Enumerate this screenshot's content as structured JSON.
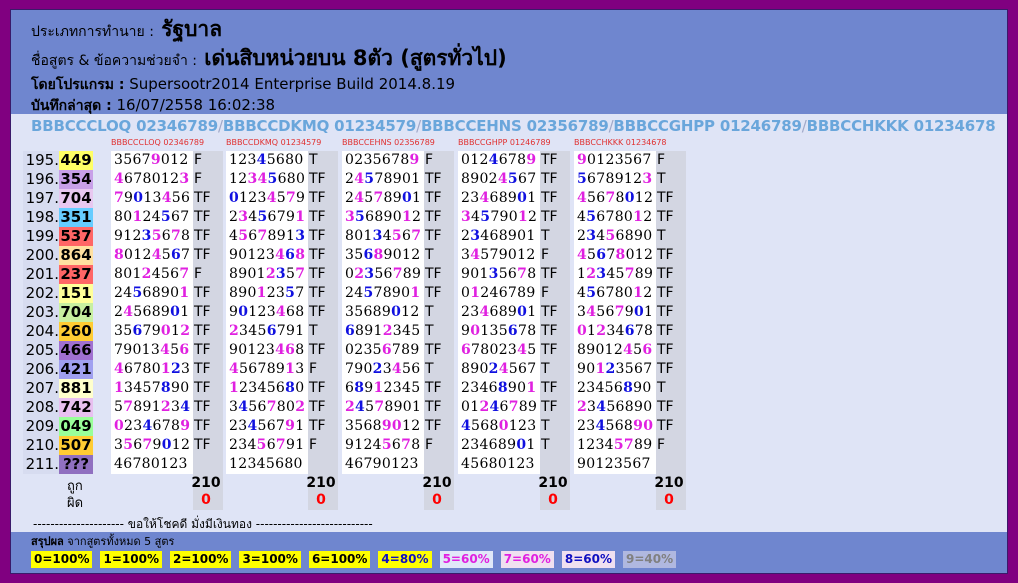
{
  "header": {
    "type_label": "ประเภทการทำนาย :",
    "type_value": "รัฐบาล",
    "formula_label": "ชื่อสูตร & ข้อความช่วยจำ :",
    "formula_value": "เด่นสิบหน่วยบน 8ตัว (สูตรทั่วไป)",
    "program_label": "โดยโปรแกรม :",
    "program_value": "Supersootr2014 Enterprise Build 2014.8.19",
    "saved_label": "บันทึกล่าสุด :",
    "saved_value": "16/07/2558 16:02:38"
  },
  "formulas": [
    {
      "name": "BBBCCCLOQ",
      "digits": "02346789"
    },
    {
      "name": "BBBCCDKMQ",
      "digits": "01234579"
    },
    {
      "name": "BBBCCEHNS",
      "digits": "02356789"
    },
    {
      "name": "BBBCCGHPP",
      "digits": "01246789"
    },
    {
      "name": "BBBCCHKKK",
      "digits": "01234678"
    }
  ],
  "column_names": [
    "BBBCCCLOQ 02346789",
    "BBBCCDKMQ 01234579",
    "BBBCCEHNS 02356789",
    "BBBCCGHPP 01246789",
    "BBBCCHKKK 01234678"
  ],
  "draws": [
    {
      "idx": "195.",
      "result": "449",
      "color": "#ffff66"
    },
    {
      "idx": "196.",
      "result": "354",
      "color": "#c8a0e8"
    },
    {
      "idx": "197.",
      "result": "704",
      "color": "#e8c8f0"
    },
    {
      "idx": "198.",
      "result": "351",
      "color": "#66ccff"
    },
    {
      "idx": "199.",
      "result": "537",
      "color": "#ff6666"
    },
    {
      "idx": "200.",
      "result": "864",
      "color": "#ffe0a0"
    },
    {
      "idx": "201.",
      "result": "237",
      "color": "#ff6666"
    },
    {
      "idx": "202.",
      "result": "151",
      "color": "#ffff99"
    },
    {
      "idx": "203.",
      "result": "704",
      "color": "#c8f0a0"
    },
    {
      "idx": "204.",
      "result": "260",
      "color": "#ffcc33"
    },
    {
      "idx": "205.",
      "result": "466",
      "color": "#a070d0"
    },
    {
      "idx": "206.",
      "result": "421",
      "color": "#a0a0f0"
    },
    {
      "idx": "207.",
      "result": "881",
      "color": "#ffffcc"
    },
    {
      "idx": "208.",
      "result": "742",
      "color": "#e8c0f0"
    },
    {
      "idx": "209.",
      "result": "049",
      "color": "#99ff99"
    },
    {
      "idx": "210.",
      "result": "507",
      "color": "#ffcc33"
    },
    {
      "idx": "211.",
      "result": "???",
      "color": "#9070c0"
    }
  ],
  "columns": [
    {
      "cells": [
        [
          "35679012",
          "F"
        ],
        [
          "46780123",
          "F"
        ],
        [
          "79013456",
          "TF"
        ],
        [
          "80124567",
          "TF"
        ],
        [
          "91235678",
          "TF"
        ],
        [
          "80124567",
          "TF"
        ],
        [
          "80124567",
          "F"
        ],
        [
          "24568901",
          "TF"
        ],
        [
          "24568901",
          "TF"
        ],
        [
          "35679012",
          "TF"
        ],
        [
          "79013456",
          "TF"
        ],
        [
          "46780123",
          "TF"
        ],
        [
          "13457890",
          "TF"
        ],
        [
          "57891234",
          "TF"
        ],
        [
          "02346789",
          "TF"
        ],
        [
          "35679012",
          "TF"
        ],
        [
          "46780123",
          ""
        ]
      ],
      "correct": "210",
      "wrong": "0"
    },
    {
      "cells": [
        [
          "12345680",
          "T"
        ],
        [
          "12345680",
          "TF"
        ],
        [
          "01234579",
          "TF"
        ],
        [
          "23456791",
          "TF"
        ],
        [
          "45678913",
          "TF"
        ],
        [
          "90123468",
          "TF"
        ],
        [
          "89012357",
          "TF"
        ],
        [
          "89012357",
          "TF"
        ],
        [
          "90123468",
          "TF"
        ],
        [
          "23456791",
          "T"
        ],
        [
          "90123468",
          "TF"
        ],
        [
          "45678913",
          "F"
        ],
        [
          "12345680",
          "TF"
        ],
        [
          "34567802",
          "TF"
        ],
        [
          "23456791",
          "TF"
        ],
        [
          "23456791",
          "F"
        ],
        [
          "12345680",
          ""
        ]
      ],
      "correct": "210",
      "wrong": "0"
    },
    {
      "cells": [
        [
          "02356789",
          "F"
        ],
        [
          "24578901",
          "TF"
        ],
        [
          "24578901",
          "TF"
        ],
        [
          "35689012",
          "TF"
        ],
        [
          "80134567",
          "TF"
        ],
        [
          "35689012",
          "T"
        ],
        [
          "02356789",
          "TF"
        ],
        [
          "24578901",
          "TF"
        ],
        [
          "35689012",
          "T"
        ],
        [
          "68912345",
          "T"
        ],
        [
          "02356789",
          "TF"
        ],
        [
          "79023456",
          "T"
        ],
        [
          "68912345",
          "TF"
        ],
        [
          "24578901",
          "TF"
        ],
        [
          "35689012",
          "TF"
        ],
        [
          "91245678",
          "F"
        ],
        [
          "46790123",
          ""
        ]
      ],
      "correct": "210",
      "wrong": "0"
    },
    {
      "cells": [
        [
          "01246789",
          "TF"
        ],
        [
          "89024567",
          "TF"
        ],
        [
          "23468901",
          "TF"
        ],
        [
          "34579012",
          "TF"
        ],
        [
          "23468901",
          "T"
        ],
        [
          "34579012",
          "F"
        ],
        [
          "90135678",
          "TF"
        ],
        [
          "01246789",
          "F"
        ],
        [
          "23468901",
          "TF"
        ],
        [
          "90135678",
          "TF"
        ],
        [
          "67802345",
          "TF"
        ],
        [
          "89024567",
          "T"
        ],
        [
          "23468901",
          "TF"
        ],
        [
          "01246789",
          "TF"
        ],
        [
          "45680123",
          "T"
        ],
        [
          "23468901",
          "T"
        ],
        [
          "45680123",
          ""
        ]
      ],
      "correct": "210",
      "wrong": "0"
    },
    {
      "cells": [
        [
          "90123567",
          "F"
        ],
        [
          "56789123",
          "T"
        ],
        [
          "45678012",
          "TF"
        ],
        [
          "45678012",
          "TF"
        ],
        [
          "23456890",
          "T"
        ],
        [
          "45678012",
          "TF"
        ],
        [
          "12345789",
          "TF"
        ],
        [
          "45678012",
          "TF"
        ],
        [
          "34567901",
          "TF"
        ],
        [
          "01234678",
          "TF"
        ],
        [
          "89012456",
          "TF"
        ],
        [
          "90123567",
          "TF"
        ],
        [
          "23456890",
          "T"
        ],
        [
          "23456890",
          "TF"
        ],
        [
          "23456890",
          "TF"
        ],
        [
          "12345789",
          "F"
        ],
        [
          "90123567",
          ""
        ]
      ],
      "correct": "210",
      "wrong": "0"
    }
  ],
  "summary_labels": {
    "correct": "ถูก",
    "wrong": "ผิด"
  },
  "footer_line": "--------------------- ขอให้โชคดี มั่งมีเงินทอง ---------------------------",
  "bottom": {
    "title": "สรุปผล",
    "subtitle": "จากสูตรทั้งหมด 5 สูตร",
    "badges": [
      {
        "text": "0=100%",
        "bg": "#ffff00",
        "fg": "#000000"
      },
      {
        "text": "1=100%",
        "bg": "#ffff00",
        "fg": "#000000"
      },
      {
        "text": "2=100%",
        "bg": "#ffff00",
        "fg": "#000000"
      },
      {
        "text": "3=100%",
        "bg": "#ffff00",
        "fg": "#000000"
      },
      {
        "text": "6=100%",
        "bg": "#ffff00",
        "fg": "#000000"
      },
      {
        "text": "4=80%",
        "bg": "#ffff00",
        "fg": "#1010c0"
      },
      {
        "text": "5=60%",
        "bg": "#e0e8f8",
        "fg": "#e020e0"
      },
      {
        "text": "7=60%",
        "bg": "#f0e0f0",
        "fg": "#e020e0"
      },
      {
        "text": "8=60%",
        "bg": "#f0e0f0",
        "fg": "#1010c0"
      },
      {
        "text": "9=40%",
        "bg": "#b0b8e0",
        "fg": "#808080"
      }
    ]
  }
}
